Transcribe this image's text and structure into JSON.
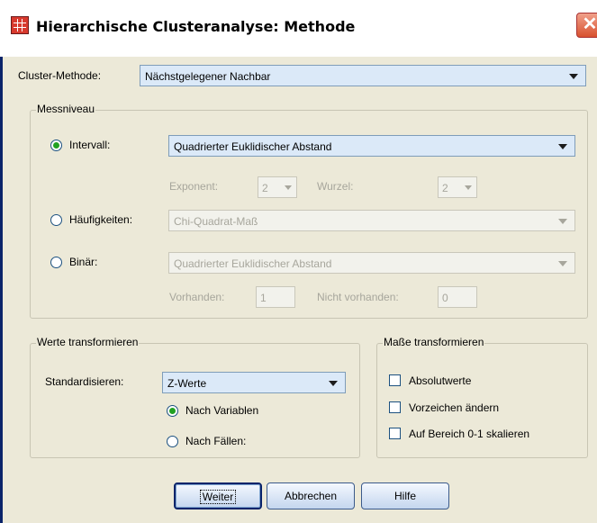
{
  "window": {
    "title": "Hierarchische Clusteranalyse: Methode"
  },
  "cluster_method": {
    "label": "Cluster-Methode:",
    "value": "Nächstgelegener Nachbar"
  },
  "messniveau": {
    "title": "Messniveau",
    "intervall": {
      "label": "Intervall:",
      "value": "Quadrierter Euklidischer Abstand",
      "selected": true
    },
    "exponent": {
      "label": "Exponent:",
      "value": "2"
    },
    "wurzel": {
      "label": "Wurzel:",
      "value": "2"
    },
    "haeufigkeiten": {
      "label": "Häufigkeiten:",
      "value": "Chi-Quadrat-Maß",
      "selected": false
    },
    "binaer": {
      "label": "Binär:",
      "value": "Quadrierter Euklidischer Abstand",
      "selected": false
    },
    "vorhanden": {
      "label": "Vorhanden:",
      "value": "1"
    },
    "nicht_vorhanden": {
      "label": "Nicht vorhanden:",
      "value": "0"
    }
  },
  "werte": {
    "title": "Werte transformieren",
    "standardisieren_label": "Standardisieren:",
    "standardisieren_value": "Z-Werte",
    "nach_variablen": {
      "label": "Nach Variablen",
      "selected": true
    },
    "nach_faellen": {
      "label": "Nach Fällen:",
      "selected": false
    }
  },
  "masse": {
    "title": "Maße transformieren",
    "options": [
      {
        "label": "Absolutwerte",
        "checked": false
      },
      {
        "label": "Vorzeichen ändern",
        "checked": false
      },
      {
        "label": "Auf Bereich 0-1 skalieren",
        "checked": false
      }
    ]
  },
  "buttons": {
    "weiter": "Weiter",
    "abbrechen": "Abbrechen",
    "hilfe": "Hilfe"
  },
  "colors": {
    "title_bar": "#ffffff",
    "dialog_bg": "#ece9d8",
    "active_dropdown": "#dbe9f8",
    "radio_dot": "#21a121",
    "close_button": "#d8512f"
  }
}
